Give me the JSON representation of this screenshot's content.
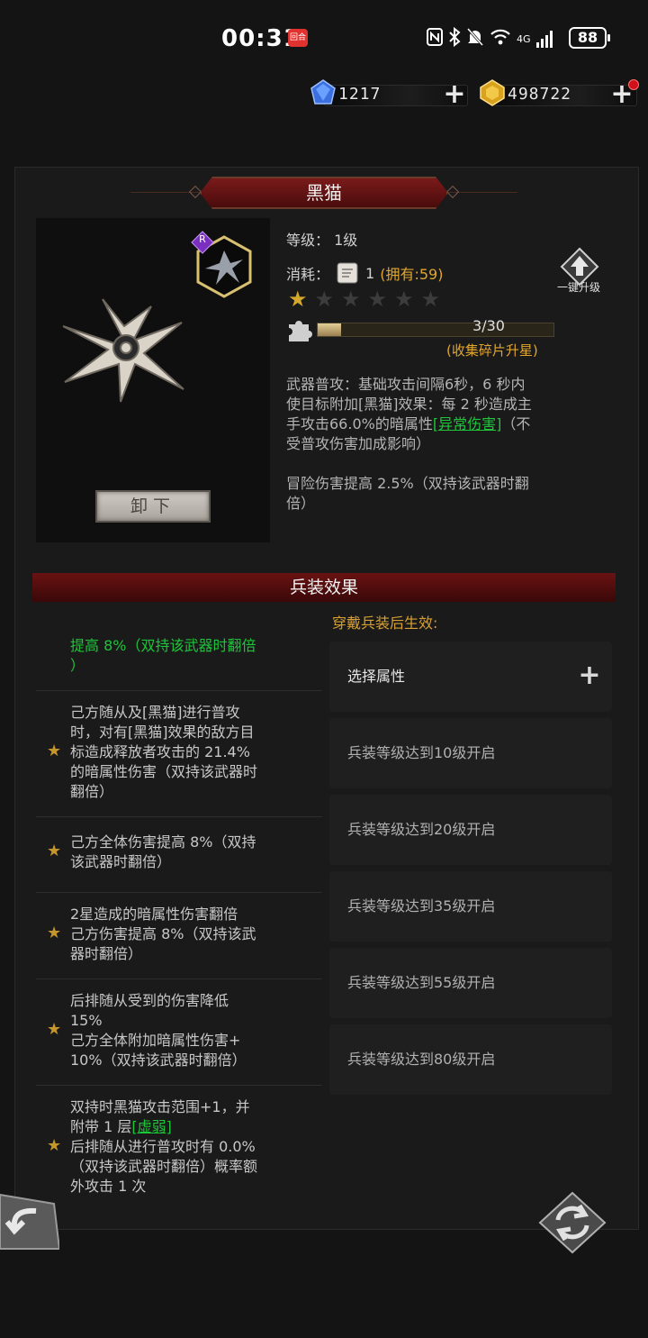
{
  "status_bar": {
    "time": "00:31",
    "app_badge": "回合",
    "network": "4G",
    "battery": "88"
  },
  "currency": {
    "diamonds": "1217",
    "gold": "498722"
  },
  "weapon": {
    "name": "黑猫",
    "rarity": "R",
    "level_label": "等级：",
    "level_value": "1级",
    "cost_label": "消耗：",
    "cost_value": "1",
    "owned": "(拥有:59)",
    "stars_filled": 1,
    "stars_total": 6,
    "fragments": "3/30",
    "fragments_fraction": 0.1,
    "fragments_tip": "(收集碎片升星)",
    "upgrade_label": "一键升级",
    "unequip_label": "卸下",
    "desc_1a": "武器普攻：基础攻击间隔6秒，6 秒内",
    "desc_1b": "使目标附加[黑猫]效果：每 2 秒造成主",
    "desc_1c": "手攻击66.0%的暗属性",
    "desc_1_link": "[异常伤害]",
    "desc_1d": "（不",
    "desc_1e": "受普攻伤害加成影响）",
    "desc_2a": "冒险伤害提高 2.5%（双持该武器时翻",
    "desc_2b": "倍）"
  },
  "effects": {
    "header": "兵装效果",
    "subtitle": "穿戴兵装后生效:",
    "items": [
      {
        "lines": [
          "提高 8%（双持该武器时翻倍",
          "）"
        ]
      },
      {
        "lines": [
          "己方随从及[黑猫]进行普攻",
          "时，对有[黑猫]效果的敌方目",
          "标造成释放者攻击的 21.4%",
          "的暗属性伤害（双持该武器时",
          "翻倍）"
        ]
      },
      {
        "lines": [
          "己方全体伤害提高 8%（双持",
          "该武器时翻倍）"
        ]
      },
      {
        "lines": [
          "2星造成的暗属性伤害翻倍",
          "己方伤害提高 8%（双持该武",
          "器时翻倍）"
        ]
      },
      {
        "lines": [
          "后排随从受到的伤害降低",
          "15%",
          "己方全体附加暗属性伤害+",
          "10%（双持该武器时翻倍）"
        ]
      },
      {
        "lines": [
          "双持时黑猫攻击范围+1，并",
          "附带 1 层",
          "后排随从进行普攻时有 0.0%",
          "（双持该武器时翻倍）概率额",
          "外攻击 1 次"
        ],
        "link": "[虚弱]"
      }
    ],
    "slots": [
      "选择属性",
      "兵装等级达到10级开启",
      "兵装等级达到20级开启",
      "兵装等级达到35级开启",
      "兵装等级达到55级开启",
      "兵装等级达到80级开启"
    ]
  },
  "colors": {
    "accent_gold": "#e1a62f",
    "link_green": "#1fc53a",
    "banner_red": "#6a1212"
  },
  "icons": [
    "blue-gem-icon",
    "gold-gem-icon",
    "plus-icon",
    "shuriken-icon",
    "scroll-icon",
    "star-icon",
    "puzzle-icon",
    "up-arrow-icon",
    "back-arrow-icon",
    "swap-icon"
  ]
}
